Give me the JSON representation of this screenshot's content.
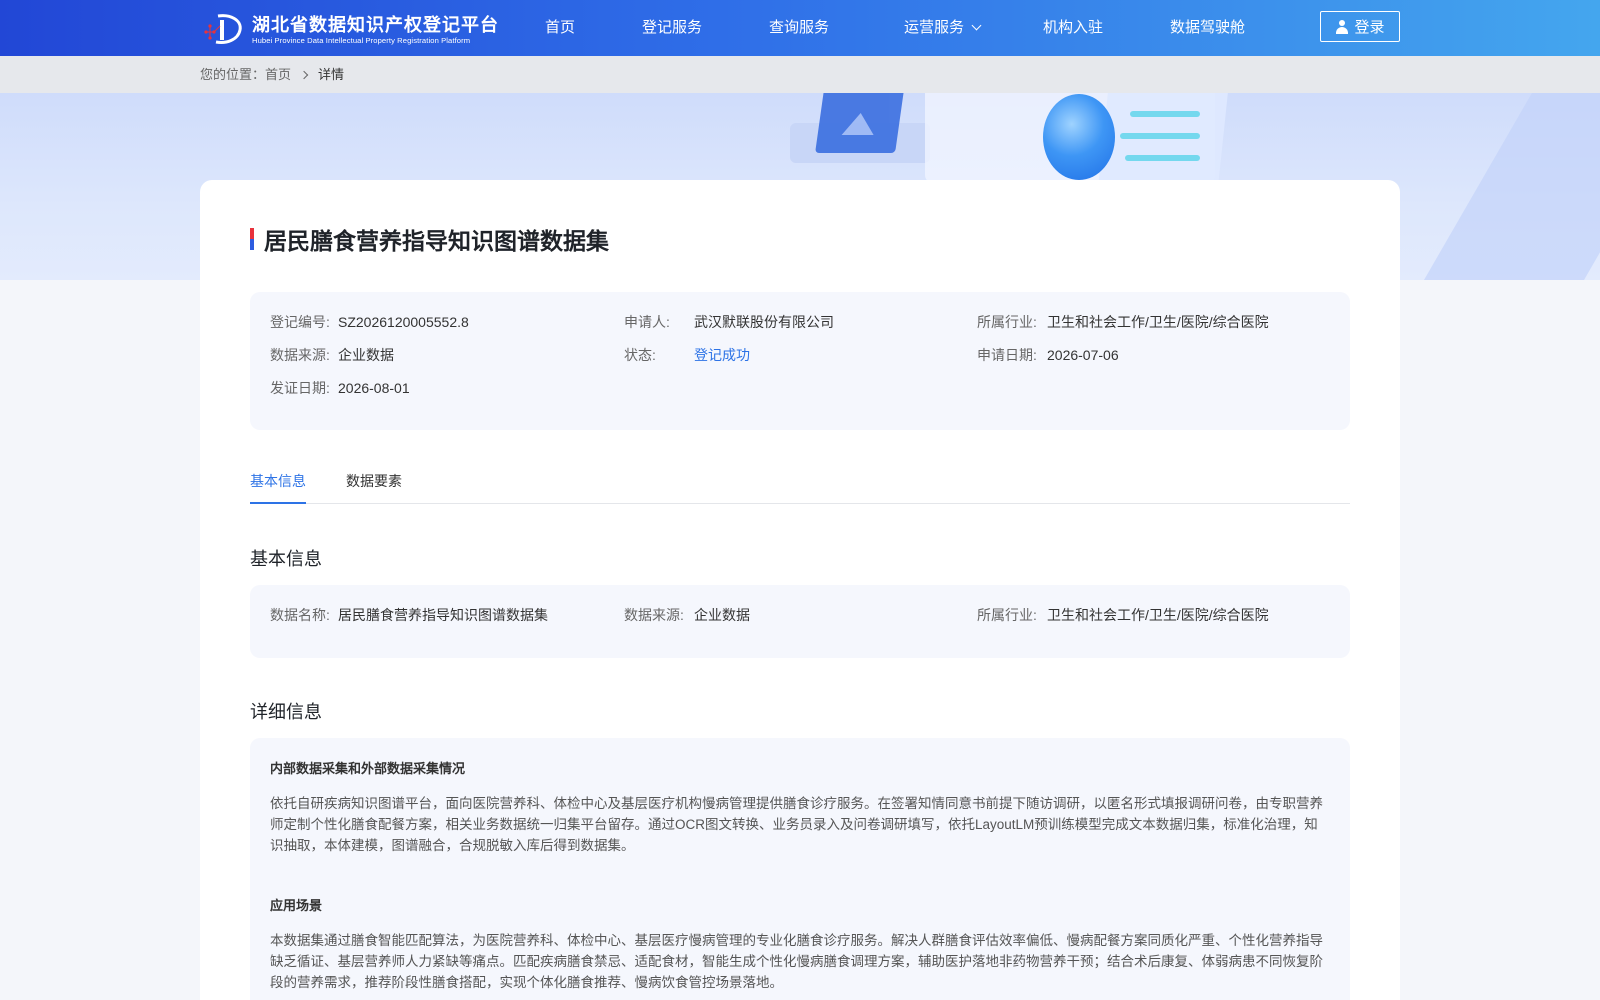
{
  "header": {
    "logo_cn": "湖北省数据知识产权登记平台",
    "logo_en": "Hubei Province Data Intellectual Property Registration Platform",
    "nav": [
      "首页",
      "登记服务",
      "查询服务",
      "运营服务",
      "机构入驻",
      "数据驾驶舱"
    ],
    "login_label": "登录"
  },
  "breadcrumb": {
    "prefix": "您的位置：",
    "home": "首页",
    "current": "详情"
  },
  "detail": {
    "title": "居民膳食营养指导知识图谱数据集",
    "summary": [
      {
        "k": "登记编号:",
        "v": "SZ2026120005552.8"
      },
      {
        "k": "申请人:",
        "v": "武汉默联股份有限公司"
      },
      {
        "k": "所属行业:",
        "v": "卫生和社会工作/卫生/医院/综合医院"
      },
      {
        "k": "数据来源:",
        "v": "企业数据"
      },
      {
        "k": "状态:",
        "v": "登记成功"
      },
      {
        "k": "申请日期:",
        "v": "2026-07-06"
      },
      {
        "k": "发证日期:",
        "v": "2026-08-01"
      }
    ],
    "tabs": [
      "基本信息",
      "数据要素"
    ],
    "basic_title": "基本信息",
    "basic": [
      {
        "k": "数据名称:",
        "v": "居民膳食营养指导知识图谱数据集"
      },
      {
        "k": "数据来源:",
        "v": "企业数据"
      },
      {
        "k": "所属行业:",
        "v": "卫生和社会工作/卫生/医院/综合医院"
      }
    ],
    "more_title": "详细信息",
    "sections": [
      {
        "heading": "内部数据采集和外部数据采集情况",
        "text": "依托自研疾病知识图谱平台，面向医院营养科、体检中心及基层医疗机构慢病管理提供膳食诊疗服务。在签署知情同意书前提下随访调研，以匿名形式填报调研问卷，由专职营养师定制个性化膳食配餐方案，相关业务数据统一归集平台留存。通过OCR图文转换、业务员录入及问卷调研填写，依托LayoutLM预训练模型完成文本数据归集，标准化治理，知识抽取，本体建模，图谱融合，合规脱敏入库后得到数据集。"
      },
      {
        "heading": "应用场景",
        "text": "本数据集通过膳食智能匹配算法，为医院营养科、体检中心、基层医疗慢病管理的专业化膳食诊疗服务。解决人群膳食评估效率偏低、慢病配餐方案同质化严重、个性化营养指导缺乏循证、基层营养师人力紧缺等痛点。匹配疾病膳食禁忌、适配食材，智能生成个性化慢病膳食调理方案，辅助医护落地非药物营养干预；结合术后康复、体弱病患不同恢复阶段的营养需求，推荐阶段性膳食搭配，实现个体化膳食推荐、慢病饮食管控场景落地。"
      }
    ]
  },
  "colors": {
    "accent": "#2d73e6",
    "header_start": "#2247d6",
    "header_end": "#44a6ee"
  }
}
